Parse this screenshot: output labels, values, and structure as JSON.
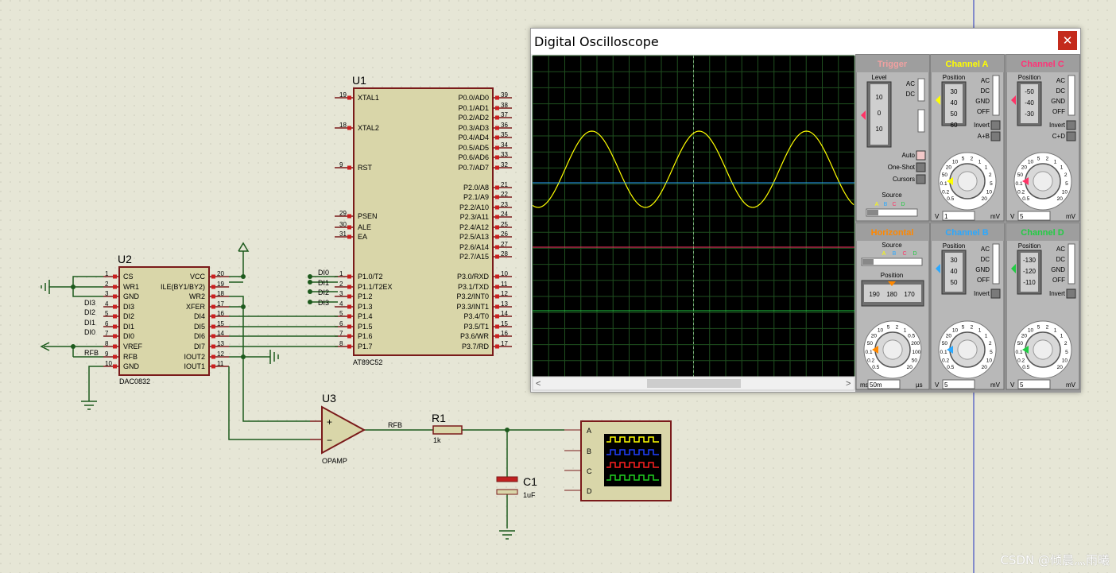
{
  "schematic": {
    "u1": {
      "ref": "U1",
      "part": "AT89C52",
      "left_pins": [
        {
          "num": "19",
          "name": "XTAL1"
        },
        {
          "num": "18",
          "name": "XTAL2"
        },
        {
          "num": "9",
          "name": "RST"
        },
        {
          "num": "29",
          "name": "PSEN"
        },
        {
          "num": "30",
          "name": "ALE"
        },
        {
          "num": "31",
          "name": "EA"
        },
        {
          "num": "1",
          "name": "P1.0/T2"
        },
        {
          "num": "2",
          "name": "P1.1/T2EX"
        },
        {
          "num": "3",
          "name": "P1.2"
        },
        {
          "num": "4",
          "name": "P1.3"
        },
        {
          "num": "5",
          "name": "P1.4"
        },
        {
          "num": "6",
          "name": "P1.5"
        },
        {
          "num": "7",
          "name": "P1.6"
        },
        {
          "num": "8",
          "name": "P1.7"
        }
      ],
      "right_pins": [
        {
          "num": "39",
          "name": "P0.0/AD0"
        },
        {
          "num": "38",
          "name": "P0.1/AD1"
        },
        {
          "num": "37",
          "name": "P0.2/AD2"
        },
        {
          "num": "36",
          "name": "P0.3/AD3"
        },
        {
          "num": "35",
          "name": "P0.4/AD4"
        },
        {
          "num": "34",
          "name": "P0.5/AD5"
        },
        {
          "num": "33",
          "name": "P0.6/AD6"
        },
        {
          "num": "32",
          "name": "P0.7/AD7"
        },
        {
          "num": "21",
          "name": "P2.0/A8"
        },
        {
          "num": "22",
          "name": "P2.1/A9"
        },
        {
          "num": "23",
          "name": "P2.2/A10"
        },
        {
          "num": "24",
          "name": "P2.3/A11"
        },
        {
          "num": "25",
          "name": "P2.4/A12"
        },
        {
          "num": "26",
          "name": "P2.5/A13"
        },
        {
          "num": "27",
          "name": "P2.6/A14"
        },
        {
          "num": "28",
          "name": "P2.7/A15"
        },
        {
          "num": "10",
          "name": "P3.0/RXD"
        },
        {
          "num": "11",
          "name": "P3.1/TXD"
        },
        {
          "num": "12",
          "name": "P3.2/INT0"
        },
        {
          "num": "13",
          "name": "P3.3/INT1"
        },
        {
          "num": "14",
          "name": "P3.4/T0"
        },
        {
          "num": "15",
          "name": "P3.5/T1"
        },
        {
          "num": "16",
          "name": "P3.6/WR"
        },
        {
          "num": "17",
          "name": "P3.7/RD"
        }
      ],
      "net_labels": [
        "DI0",
        "DI1",
        "DI2",
        "DI3"
      ]
    },
    "u2": {
      "ref": "U2",
      "part": "DAC0832",
      "left_pins": [
        {
          "num": "1",
          "name": "CS"
        },
        {
          "num": "2",
          "name": "WR1"
        },
        {
          "num": "3",
          "name": "GND"
        },
        {
          "num": "4",
          "name": "DI3"
        },
        {
          "num": "5",
          "name": "DI2"
        },
        {
          "num": "6",
          "name": "DI1"
        },
        {
          "num": "7",
          "name": "DI0"
        },
        {
          "num": "8",
          "name": "VREF"
        },
        {
          "num": "9",
          "name": "RFB"
        },
        {
          "num": "10",
          "name": "GND"
        }
      ],
      "right_pins": [
        {
          "num": "20",
          "name": "VCC"
        },
        {
          "num": "19",
          "name": "ILE(BY1/BY2)"
        },
        {
          "num": "18",
          "name": "WR2"
        },
        {
          "num": "17",
          "name": "XFER"
        },
        {
          "num": "16",
          "name": "DI4"
        },
        {
          "num": "15",
          "name": "DI5"
        },
        {
          "num": "14",
          "name": "DI6"
        },
        {
          "num": "13",
          "name": "DI7"
        },
        {
          "num": "12",
          "name": "IOUT2"
        },
        {
          "num": "11",
          "name": "IOUT1"
        }
      ],
      "net_labels": [
        "DI3",
        "DI2",
        "DI1",
        "DI0",
        "RFB"
      ]
    },
    "u3": {
      "ref": "U3",
      "part": "OPAMP",
      "plus": "+",
      "minus": "−",
      "net": "RFB"
    },
    "r1": {
      "ref": "R1",
      "value": "1k"
    },
    "c1": {
      "ref": "C1",
      "value": "1uF"
    },
    "scope_symbol": {
      "pins": [
        "A",
        "B",
        "C",
        "D"
      ]
    },
    "watermark": "CSDN @倾晨灬雨曦"
  },
  "oscilloscope": {
    "title": "Digital Oscilloscope",
    "close_glyph": "✕",
    "sections": {
      "trigger": "Trigger",
      "channel_a": "Channel A",
      "channel_c": "Channel C",
      "horizontal": "Horizontal",
      "channel_b": "Channel B",
      "channel_d": "Channel D"
    },
    "trigger": {
      "level_label": "Level",
      "scale": [
        "10",
        "0",
        "10"
      ],
      "ac": "AC",
      "dc": "DC",
      "auto": "Auto",
      "one_shot": "One-Shot",
      "cursors": "Cursors",
      "source_label": "Source",
      "sources": [
        "A",
        "B",
        "C",
        "D"
      ]
    },
    "channel_a": {
      "position_label": "Position",
      "scale": [
        "30",
        "40",
        "50",
        "60"
      ],
      "ac": "AC",
      "dc": "DC",
      "gnd": "GND",
      "off": "OFF",
      "invert": "Invert",
      "extra": "A+B",
      "unit_v": "V",
      "value": "1",
      "unit": "mV",
      "dial": [
        "0.5",
        "0.2",
        "0.1",
        "50",
        "20",
        "10",
        "5",
        "2",
        "1",
        "1",
        "2",
        "5",
        "10",
        "20"
      ]
    },
    "channel_b": {
      "position_label": "Position",
      "scale": [
        "30",
        "40",
        "50"
      ],
      "ac": "AC",
      "dc": "DC",
      "gnd": "GND",
      "off": "OFF",
      "invert": "Invert",
      "unit_v": "V",
      "value": "5",
      "unit": "mV",
      "dial": [
        "0.5",
        "0.2",
        "0.1",
        "50",
        "20",
        "10",
        "5",
        "2",
        "1",
        "1",
        "2",
        "5",
        "10",
        "20"
      ]
    },
    "channel_c": {
      "position_label": "Position",
      "scale": [
        "-50",
        "-40",
        "-30"
      ],
      "ac": "AC",
      "dc": "DC",
      "gnd": "GND",
      "off": "OFF",
      "invert": "Invert",
      "extra": "C+D",
      "unit_v": "V",
      "value": "5",
      "unit": "mV",
      "dial": [
        "0.5",
        "0.2",
        "0.1",
        "50",
        "20",
        "10",
        "5",
        "2",
        "1",
        "1",
        "2",
        "5",
        "10",
        "20"
      ]
    },
    "channel_d": {
      "position_label": "Position",
      "scale": [
        "-130",
        "-120",
        "-110"
      ],
      "ac": "AC",
      "dc": "DC",
      "gnd": "GND",
      "off": "OFF",
      "invert": "Invert",
      "unit_v": "V",
      "value": "5",
      "unit": "mV",
      "dial": [
        "0.5",
        "0.2",
        "0.1",
        "50",
        "20",
        "10",
        "5",
        "2",
        "1",
        "1",
        "2",
        "5",
        "10",
        "20"
      ]
    },
    "horizontal": {
      "source_label": "Source",
      "sources": [
        "A",
        "B",
        "C",
        "D"
      ],
      "position_label": "Position",
      "scale": [
        "190",
        "180",
        "170"
      ],
      "unit_left": "ms",
      "value": "50m",
      "unit_right": "µs",
      "dial": [
        "0.5",
        "0.2",
        "0.1",
        "50",
        "20",
        "10",
        "5",
        "2",
        "1",
        "0.5",
        "200",
        "100",
        "50",
        "20"
      ]
    },
    "colors": {
      "screen_bg": "#000000",
      "grid": "#1f4f1f",
      "trace_a": "#ffff00",
      "trace_b": "#2aa8ff",
      "trace_c": "#ff3366",
      "trace_d": "#22cc44",
      "horizontal": "#ff8800"
    },
    "traces": {
      "channel_a": {
        "waveform": "sine",
        "cycles_visible": 3
      },
      "channel_b": {
        "waveform": "flat"
      },
      "channel_c": {
        "waveform": "flat"
      },
      "channel_d": {
        "waveform": "flat"
      }
    }
  }
}
